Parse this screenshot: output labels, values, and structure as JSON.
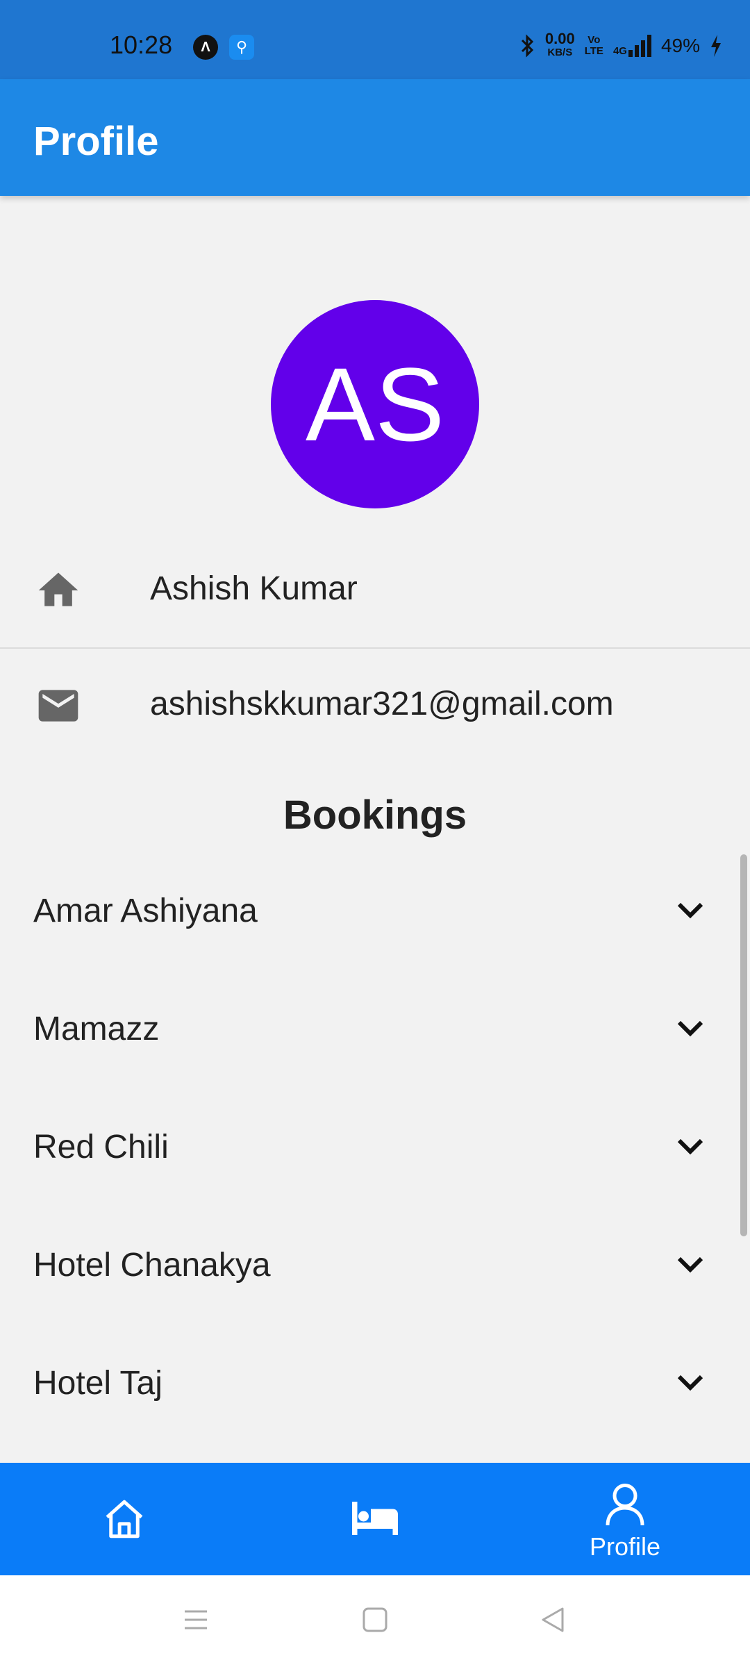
{
  "status_bar": {
    "time": "10:28",
    "badge_a": "Λ",
    "badge_usb": "⚲",
    "net_speed_value": "0.00",
    "net_speed_unit": "KB/S",
    "volte_top": "Vo",
    "volte_bottom": "LTE",
    "network": "4G",
    "battery": "49%"
  },
  "app_bar": {
    "title": "Profile"
  },
  "avatar": {
    "initials": "AS",
    "color": "#6200ea"
  },
  "user": {
    "name": "Ashish Kumar",
    "email": "ashishskkumar321@gmail.com"
  },
  "bookings": {
    "heading": "Bookings",
    "items": [
      {
        "label": "Amar Ashiyana"
      },
      {
        "label": "Mamazz"
      },
      {
        "label": "Red Chili"
      },
      {
        "label": "Hotel Chanakya"
      },
      {
        "label": "Hotel Taj"
      }
    ]
  },
  "bottom_nav": {
    "items": [
      {
        "icon": "home-icon"
      },
      {
        "icon": "bed-icon"
      },
      {
        "icon": "person-icon",
        "label": "Profile"
      }
    ],
    "active": "Profile",
    "color": "#0a7cf8"
  },
  "colors": {
    "status_bar": "#1f76d0",
    "app_bar": "#1e88e5",
    "background": "#f2f2f2"
  }
}
